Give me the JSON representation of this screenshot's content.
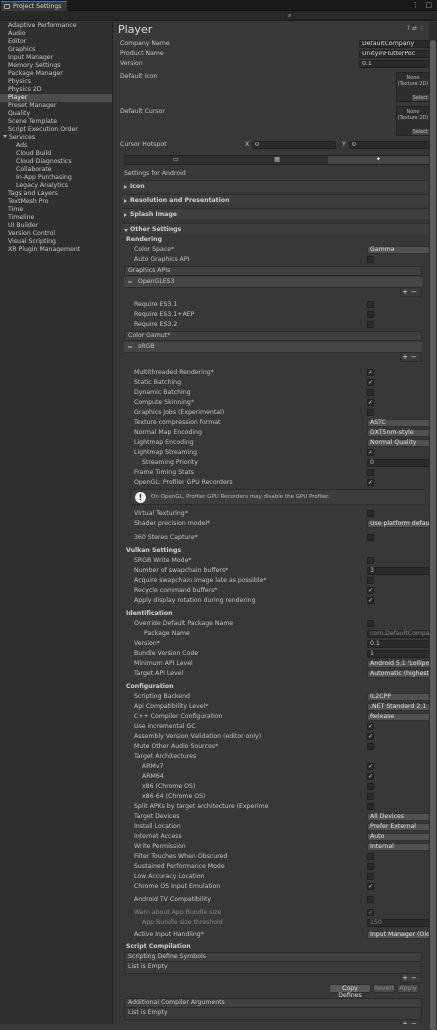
{
  "window": {
    "tab_title": "Project Settings"
  },
  "sidebar": {
    "items": [
      {
        "label": "Adaptive Performance",
        "level": 0
      },
      {
        "label": "Audio",
        "level": 0
      },
      {
        "label": "Editor",
        "level": 0
      },
      {
        "label": "Graphics",
        "level": 0
      },
      {
        "label": "Input Manager",
        "level": 0
      },
      {
        "label": "Memory Settings",
        "level": 0
      },
      {
        "label": "Package Manager",
        "level": 0
      },
      {
        "label": "Physics",
        "level": 0
      },
      {
        "label": "Physics 2D",
        "level": 0
      },
      {
        "label": "Player",
        "level": 0,
        "selected": true
      },
      {
        "label": "Preset Manager",
        "level": 0
      },
      {
        "label": "Quality",
        "level": 0
      },
      {
        "label": "Scene Template",
        "level": 0
      },
      {
        "label": "Script Execution Order",
        "level": 0
      },
      {
        "label": "Services",
        "level": 0,
        "expanded": true
      },
      {
        "label": "Ads",
        "level": 1
      },
      {
        "label": "Cloud Build",
        "level": 1
      },
      {
        "label": "Cloud Diagnostics",
        "level": 1
      },
      {
        "label": "Collaborate",
        "level": 1
      },
      {
        "label": "In-App Purchasing",
        "level": 1
      },
      {
        "label": "Legacy Analytics",
        "level": 1
      },
      {
        "label": "Tags and Layers",
        "level": 0
      },
      {
        "label": "TextMesh Pro",
        "level": 0
      },
      {
        "label": "Time",
        "level": 0
      },
      {
        "label": "Timeline",
        "level": 0
      },
      {
        "label": "UI Builder",
        "level": 0
      },
      {
        "label": "Version Control",
        "level": 0
      },
      {
        "label": "Visual Scripting",
        "level": 0
      },
      {
        "label": "XR Plugin Management",
        "level": 0
      }
    ]
  },
  "player": {
    "title": "Player",
    "company_label": "Company Name",
    "company_value": "DefaultCompany",
    "product_label": "Product Name",
    "product_value": "UnityInFlutterPoc",
    "version_label": "Version",
    "version_value": "0.1",
    "icon_label": "Default Icon",
    "cursor_label": "Default Cursor",
    "texture_none": "None",
    "texture_type": "(Texture 2D)",
    "texture_select": "Select",
    "hotspot_label": "Cursor Hotspot",
    "hotspot_x_label": "X",
    "hotspot_x": "0",
    "hotspot_y_label": "Y",
    "hotspot_y": "0",
    "settings_for": "Settings for Android"
  },
  "sections": {
    "icon": "Icon",
    "resolution": "Resolution and Presentation",
    "splash": "Splash Image",
    "other": "Other Settings"
  },
  "rendering": {
    "header": "Rendering",
    "color_space_label": "Color Space*",
    "color_space": "Gamma",
    "auto_graphics_label": "Auto Graphics API",
    "auto_graphics": false,
    "graphics_apis_header": "Graphics APIs",
    "graphics_apis": [
      "OpenGLES3"
    ],
    "req_es31_label": "Require ES3.1",
    "req_es31_aep_label": "Require ES3.1+AEP",
    "req_es32_label": "Require ES3.2",
    "color_gamut_header": "Color Gamut*",
    "color_gamut": [
      "sRGB"
    ],
    "toggles": [
      {
        "label": "Multithreaded Rendering*",
        "checked": true
      },
      {
        "label": "Static Batching",
        "checked": true
      },
      {
        "label": "Dynamic Batching",
        "checked": false
      },
      {
        "label": "Compute Skinning*",
        "checked": true
      },
      {
        "label": "Graphics Jobs (Experimental)",
        "checked": false
      }
    ],
    "texture_compression_label": "Texture compression format",
    "texture_compression": "ASTC",
    "normal_map_label": "Normal Map Encoding",
    "normal_map": "DXT5nm-style",
    "lightmap_enc_label": "Lightmap Encoding",
    "lightmap_enc": "Normal Quality",
    "lightmap_stream_label": "Lightmap Streaming",
    "lightmap_stream": true,
    "stream_priority_label": "Streaming Priority",
    "stream_priority": "0",
    "frame_timing_label": "Frame Timing Stats",
    "frame_timing": false,
    "gpu_recorders_label": "OpenGL: Profiler GPU Recorders",
    "gpu_recorders": true,
    "gpu_info": "On OpenGL, Profiler GPU Recorders may disable the GPU Profiler.",
    "virtual_texturing_label": "Virtual Texturing*",
    "virtual_texturing": false,
    "shader_precision_label": "Shader precision model*",
    "shader_precision": "Use platform defaults for sampler precision",
    "stereo_label": "360 Stereo Capture*",
    "stereo": false
  },
  "vulkan": {
    "header": "Vulkan Settings",
    "srgb_label": "SRGB Write Mode*",
    "srgb": false,
    "swapchain_label": "Number of swapchain buffers*",
    "swapchain": "3",
    "acquire_label": "Acquire swapchain image late as possible*",
    "acquire": false,
    "recycle_label": "Recycle command buffers*",
    "recycle": true,
    "rotation_label": "Apply display rotation during rendering",
    "rotation": true
  },
  "identification": {
    "header": "Identification",
    "override_label": "Override Default Package Name",
    "override": false,
    "package_label": "Package Name",
    "package": "com.DefaultCompany.UnityInFlutterPoc",
    "version_label": "Version*",
    "version": "0.1",
    "bundle_label": "Bundle Version Code",
    "bundle": "1",
    "min_api_label": "Minimum API Level",
    "min_api": "Android 5.1 'Lollipop' (API level 22)",
    "target_api_label": "Target API Level",
    "target_api": "Automatic (highest installed)"
  },
  "configuration": {
    "header": "Configuration",
    "backend_label": "Scripting Backend",
    "backend": "IL2CPP",
    "api_compat_label": "Api Compatibility Level*",
    "api_compat": ".NET Standard 2.1",
    "cpp_label": "C++ Compiler Configuration",
    "cpp": "Release",
    "incremental_label": "Use incremental GC",
    "incremental": true,
    "assembly_label": "Assembly Version Validation (editor only)",
    "assembly": true,
    "mute_label": "Mute Other Audio Sources*",
    "mute": false,
    "target_arch_label": "Target Architectures",
    "archs": [
      {
        "label": "ARMv7",
        "checked": true
      },
      {
        "label": "ARM64",
        "checked": true
      },
      {
        "label": "x86 (Chrome OS)",
        "checked": false
      },
      {
        "label": "x86-64 (Chrome OS)",
        "checked": false
      }
    ],
    "split_label": "Split APKs by target architecture (Experime",
    "split": false,
    "target_devices_label": "Target Devices",
    "target_devices": "All Devices",
    "install_label": "Install Location",
    "install": "Prefer External",
    "internet_label": "Internet Access",
    "internet": "Auto",
    "write_label": "Write Permission",
    "write": "Internal",
    "filter_label": "Filter Touches When Obscured",
    "filter": false,
    "sustained_label": "Sustained Performance Mode",
    "sustained": false,
    "lowacc_label": "Low Accuracy Location",
    "lowacc": false,
    "chromeos_label": "Chrome OS Input Emulation",
    "chromeos": true,
    "tv_label": "Android TV Compatibility",
    "tv": false,
    "warn_label": "Warn about App Bundle size",
    "warn": true,
    "threshold_label": "App Bundle size threshold",
    "threshold": "150",
    "input_label": "Active Input Handling*",
    "input": "Input Manager (Old)"
  },
  "script_compilation": {
    "header": "Script Compilation",
    "define_header": "Scripting Define Symbols",
    "list_empty": "List is Empty",
    "copy_defines": "Copy Defines",
    "revert": "Revert",
    "apply": "Apply",
    "compiler_args_header": "Additional Compiler Arguments",
    "list_empty2": "List is Empty"
  }
}
